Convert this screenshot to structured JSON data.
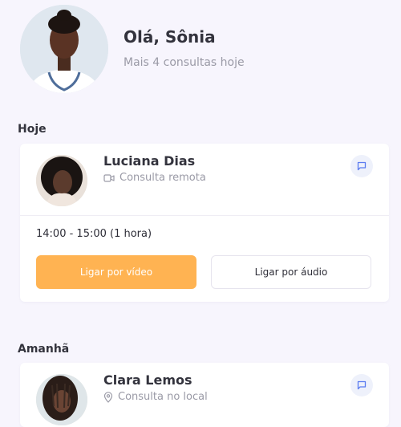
{
  "header": {
    "greeting": "Olá, Sônia",
    "subtitle": "Mais 4 consultas hoje"
  },
  "sections": [
    {
      "title": "Hoje",
      "appointment": {
        "patient_name": "Luciana Dias",
        "type": "Consulta remota",
        "type_icon": "video-camera-icon",
        "time": "14:00 - 15:00 (1 hora)",
        "video_button": "Ligar por vídeo",
        "audio_button": "Ligar por áudio"
      }
    },
    {
      "title": "Amanhã",
      "appointment": {
        "patient_name": "Clara Lemos",
        "type": "Consulta no local",
        "type_icon": "location-pin-icon"
      }
    }
  ],
  "colors": {
    "background": "#f7f5fd",
    "accent": "#ffb352",
    "chat_icon": "#5b7cf0"
  }
}
